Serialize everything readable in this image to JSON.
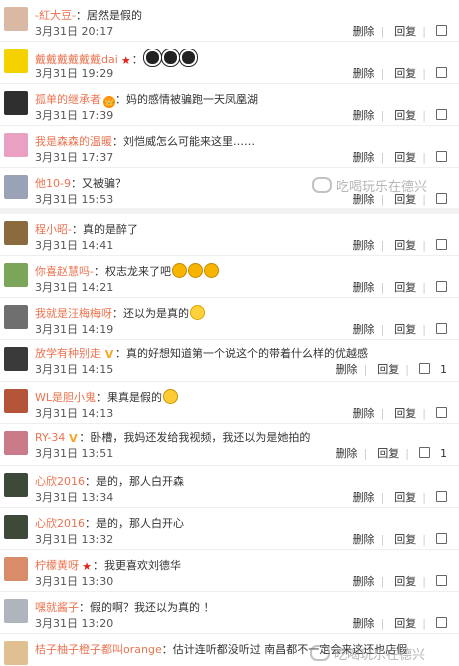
{
  "actions": {
    "delete": "删除",
    "reply": "回复"
  },
  "comments_a": [
    {
      "name": "-紅大豆-",
      "text": "居然是假的",
      "time": "3月31日 20:17",
      "avatar_color": "#d9b9a3"
    },
    {
      "name": "戴戴戴戴戴戴dai",
      "badge": "★",
      "text": "",
      "emoji": [
        "eye",
        "eye",
        "eye"
      ],
      "time": "3月31日 19:29",
      "avatar_color": "#f5d100"
    },
    {
      "name": "孤单的继承者",
      "badge": "👑",
      "text": "妈的感情被骗跑一天凤凰湖",
      "time": "3月31日 17:39",
      "avatar_color": "#2f2f2f"
    },
    {
      "name": "我是森森的温暖",
      "text": "刘恺威怎么可能来这里……",
      "time": "3月31日 17:37",
      "avatar_color": "#e9a0c3"
    },
    {
      "name": "他10-9",
      "text": "又被骗？",
      "time": "3月31日 15:53",
      "avatar_color": "#9aa3b5"
    }
  ],
  "watermark_a": "吃喝玩乐在德兴",
  "comments_b": [
    {
      "name": "程小昭-",
      "text": "真的是醉了",
      "time": "3月31日 14:41",
      "avatar_color": "#8b6a3e"
    },
    {
      "name": "你喜赵慧吗-",
      "text": "权志龙来了吧",
      "emoji": [
        "laugh",
        "laugh",
        "laugh"
      ],
      "time": "3月31日 14:21",
      "avatar_color": "#7ba65a"
    },
    {
      "name": "我就是汪梅梅呀",
      "text": "还以为是真的",
      "emoji": [
        "sun"
      ],
      "time": "3月31日 14:19",
      "avatar_color": "#6f6f6f"
    },
    {
      "name": "放学有种别走",
      "badge": "V",
      "text": "真的好想知道第一个说这个的带着什么样的优越感",
      "time": "3月31日 14:15",
      "avatar_color": "#3a3a3a",
      "likes": "1"
    },
    {
      "name": "WL是胆小鬼",
      "text": "果真是假的",
      "emoji": [
        "shades"
      ],
      "time": "3月31日 14:13",
      "avatar_color": "#b4553a"
    },
    {
      "name": "RY-34",
      "badge": "V",
      "text": "卧槽，我妈还发给我视频，我还以为是她拍的",
      "time": "3月31日 13:51",
      "avatar_color": "#c97b8a",
      "likes": "1"
    },
    {
      "name": "心欣2016",
      "text": "是的，那人白开森",
      "time": "3月31日 13:34",
      "avatar_color": "#3d4a3a"
    },
    {
      "name": "心欣2016",
      "text": "是的，那人白开心",
      "time": "3月31日 13:32",
      "avatar_color": "#3d4a3a"
    },
    {
      "name": "柠檬黄呀",
      "badge": "★",
      "text": "我更喜欢刘德华",
      "time": "3月31日 13:30",
      "avatar_color": "#d98c6a"
    },
    {
      "name": "嘿就酱子",
      "text": "假的啊？我还以为真的 ！",
      "time": "3月31日 13:20",
      "avatar_color": "#b0b4bd"
    },
    {
      "name": "桔子柚子橙子都叫orange",
      "text": "估计连听都没听过 南昌都不一定会来这还也店假",
      "time": "",
      "avatar_color": "#e0c090"
    }
  ],
  "watermark_b": "吃喝玩乐在德兴"
}
